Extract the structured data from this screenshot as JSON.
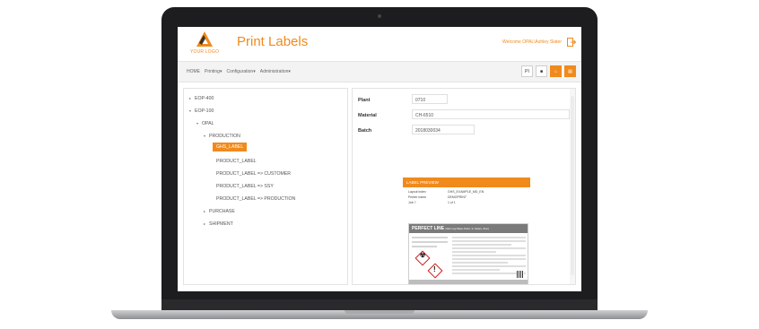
{
  "header": {
    "logo_text": "YOUR LOGO",
    "title": "Print Labels",
    "welcome": "Welcome OPAL\\Ashley Slater",
    "accent_color": "#f08a1c"
  },
  "nav": {
    "items": [
      "HOME",
      "Printing▾",
      "Configuration▾",
      "Administration▾"
    ],
    "buttons": [
      "PI",
      "■",
      "⌂",
      "▤"
    ]
  },
  "tree": {
    "nodes": [
      {
        "label": "EOP-400",
        "arrow": "▸"
      },
      {
        "label": "EOP-100",
        "arrow": "▾"
      },
      {
        "label": "OPAL",
        "arrow": "▾"
      },
      {
        "label": "PRODUCTION",
        "arrow": "▾"
      },
      {
        "label": "GHS_LABEL",
        "selected": true
      },
      {
        "label": "PRODUCT_LABEL"
      },
      {
        "label": "PRODUCT_LABEL => CUSTOMER"
      },
      {
        "label": "PRODUCT_LABEL => SSY"
      },
      {
        "label": "PRODUCT_LABEL => PRODUCTION"
      },
      {
        "label": "PURCHASE",
        "arrow": "▸"
      },
      {
        "label": "SHIPMENT",
        "arrow": "▸"
      }
    ]
  },
  "form": {
    "plant_label": "Plant",
    "plant_value": "0710",
    "material_label": "Material",
    "material_value": "CH-6510",
    "batch_label": "Batch",
    "batch_value": "2018030034"
  },
  "preview": {
    "header": "LABEL PREVIEW",
    "rows": [
      {
        "k": "Layout index",
        "v": "GHS_EXAMPLE_MD_EN"
      },
      {
        "k": "Printer name",
        "v": "DEMOPRINT"
      },
      {
        "k": "Job ?",
        "v": "1 of 1"
      }
    ],
    "card_title": "PERFECT LINE",
    "card_subtitle": "(Wet Lap Base Paint, In Glass, Zinc)"
  }
}
